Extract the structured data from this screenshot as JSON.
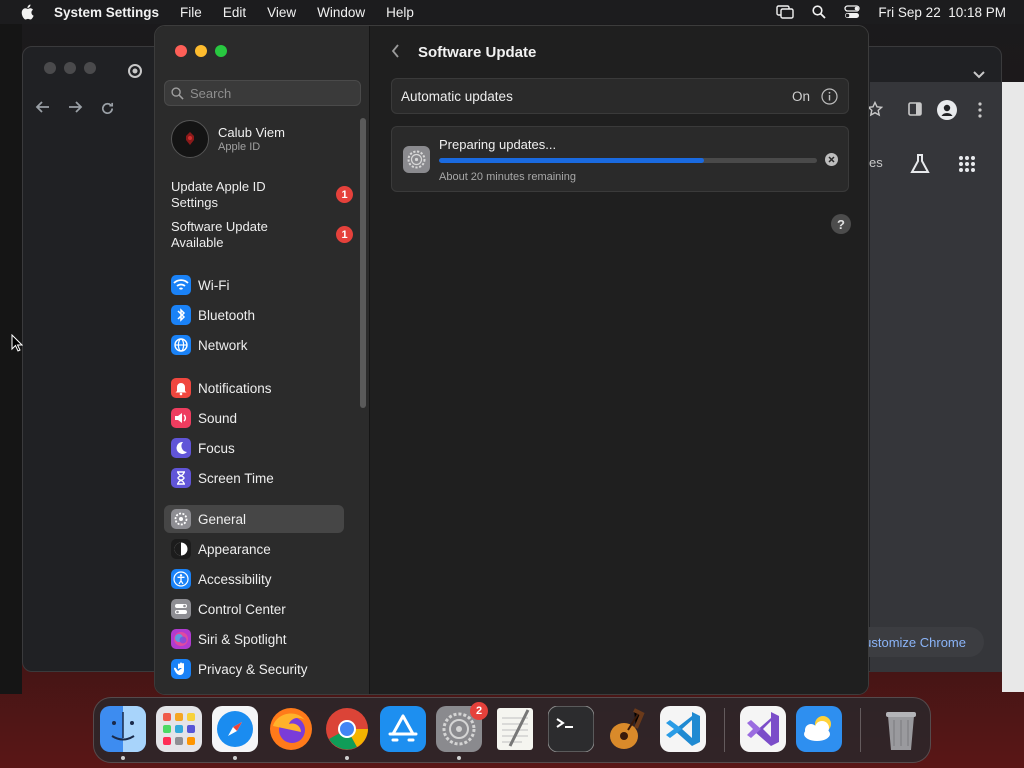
{
  "menubar": {
    "app_name": "System Settings",
    "items": [
      "File",
      "Edit",
      "View",
      "Window",
      "Help"
    ],
    "clock": "Fri Sep 22  10:18 PM"
  },
  "chrome": {
    "customize_label": "ustomize Chrome",
    "partial_text": "es"
  },
  "sidebar": {
    "search_placeholder": "Search",
    "profile": {
      "name": "Calub Viem",
      "subtitle": "Apple ID"
    },
    "notices": [
      {
        "label": "Update Apple ID Settings",
        "badge": "1"
      },
      {
        "label": "Software Update Available",
        "badge": "1"
      }
    ],
    "items": [
      {
        "label": "Wi-Fi",
        "icon": "wifi-icon",
        "color": "#1a82f7"
      },
      {
        "label": "Bluetooth",
        "icon": "bluetooth-icon",
        "color": "#1a82f7"
      },
      {
        "label": "Network",
        "icon": "network-globe-icon",
        "color": "#1a82f7"
      },
      {
        "label": "Notifications",
        "icon": "bell-icon",
        "color": "#f0473f"
      },
      {
        "label": "Sound",
        "icon": "speaker-icon",
        "color": "#ee3d5f"
      },
      {
        "label": "Focus",
        "icon": "moon-icon",
        "color": "#6155d8"
      },
      {
        "label": "Screen Time",
        "icon": "hourglass-icon",
        "color": "#6155d8"
      },
      {
        "label": "General",
        "icon": "gear-icon",
        "color": "#8e8e93",
        "selected": true
      },
      {
        "label": "Appearance",
        "icon": "appearance-icon",
        "color": "#1c1c1c"
      },
      {
        "label": "Accessibility",
        "icon": "accessibility-icon",
        "color": "#1a82f7"
      },
      {
        "label": "Control Center",
        "icon": "control-center-icon",
        "color": "#8e8e93"
      },
      {
        "label": "Siri & Spotlight",
        "icon": "siri-icon",
        "color": "#b03bd0"
      },
      {
        "label": "Privacy & Security",
        "icon": "hand-icon",
        "color": "#1a82f7"
      }
    ]
  },
  "content": {
    "title": "Software Update",
    "automatic_updates": {
      "label": "Automatic updates",
      "status": "On"
    },
    "update": {
      "title": "Preparing updates...",
      "remaining": "About 20 minutes remaining",
      "progress": 0.7
    }
  },
  "dock": {
    "apps": [
      {
        "name": "Finder",
        "icon": "finder-icon",
        "running": true
      },
      {
        "name": "Launchpad",
        "icon": "launchpad-icon",
        "running": false
      },
      {
        "name": "Safari",
        "icon": "safari-icon",
        "running": true
      },
      {
        "name": "Firefox",
        "icon": "firefox-icon",
        "running": false
      },
      {
        "name": "Google Chrome",
        "icon": "chrome-icon",
        "running": true
      },
      {
        "name": "App Store",
        "icon": "app-store-icon",
        "running": false
      },
      {
        "name": "System Settings",
        "icon": "system-settings-icon",
        "running": true,
        "badge": "2"
      },
      {
        "name": "TextEdit",
        "icon": "textedit-icon",
        "running": false
      },
      {
        "name": "Terminal",
        "icon": "terminal-icon",
        "running": false
      },
      {
        "name": "GarageBand",
        "icon": "garageband-icon",
        "running": false
      },
      {
        "name": "Visual Studio Code",
        "icon": "vscode-icon",
        "running": false
      },
      {
        "name": "Visual Studio",
        "icon": "visual-studio-icon",
        "running": false
      },
      {
        "name": "Weather",
        "icon": "weather-icon",
        "running": false
      },
      {
        "name": "Trash",
        "icon": "trash-icon",
        "running": false
      }
    ]
  }
}
